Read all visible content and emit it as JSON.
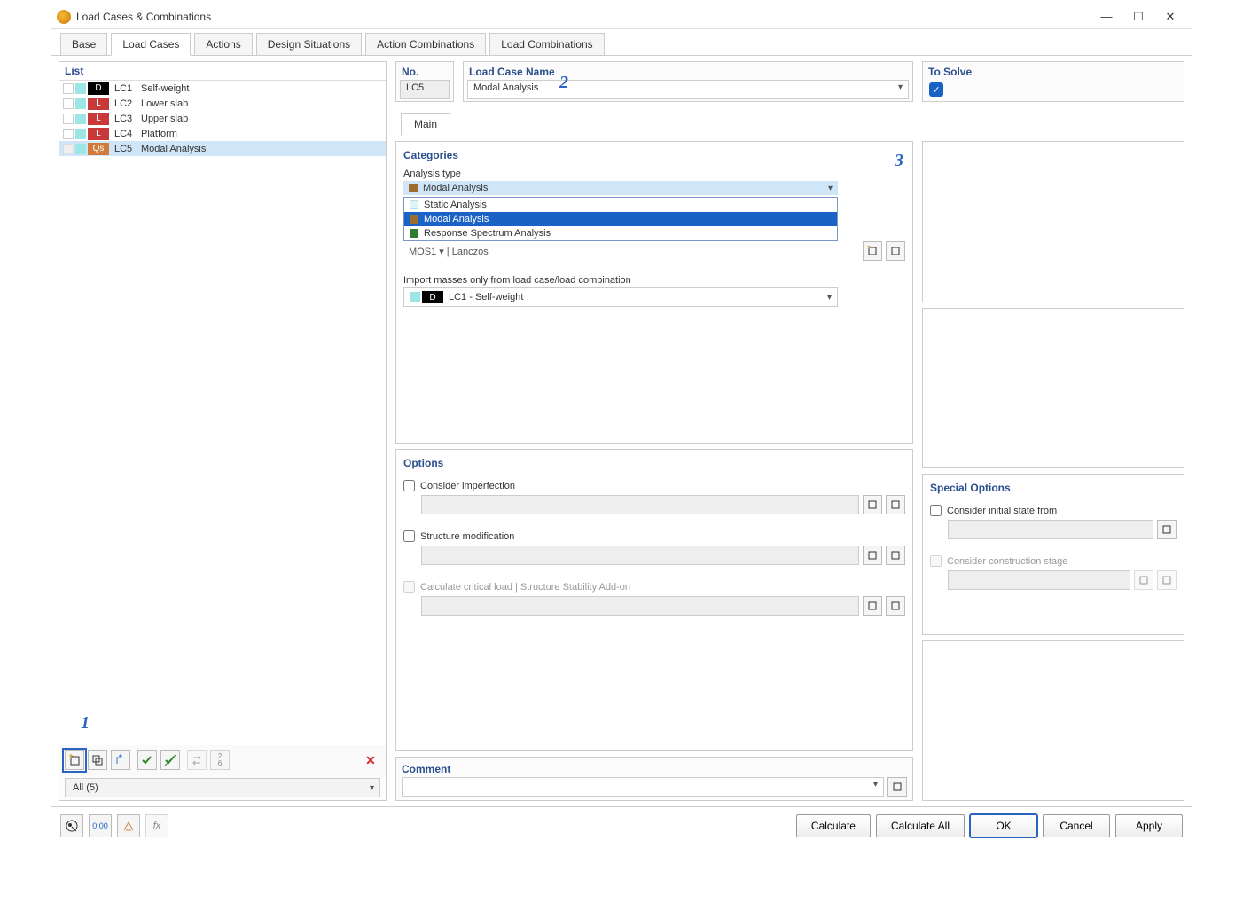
{
  "window": {
    "title": "Load Cases & Combinations"
  },
  "main_tabs": [
    "Base",
    "Load Cases",
    "Actions",
    "Design Situations",
    "Action Combinations",
    "Load Combinations"
  ],
  "active_tab": 1,
  "list": {
    "head": "List",
    "items": [
      {
        "id": "LC1",
        "tag": "D",
        "tagcls": "d",
        "name": "Self-weight"
      },
      {
        "id": "LC2",
        "tag": "L",
        "tagcls": "l",
        "name": "Lower slab"
      },
      {
        "id": "LC3",
        "tag": "L",
        "tagcls": "l",
        "name": "Upper slab"
      },
      {
        "id": "LC4",
        "tag": "L",
        "tagcls": "l",
        "name": "Platform"
      },
      {
        "id": "LC5",
        "tag": "Qs",
        "tagcls": "qs",
        "name": "Modal Analysis",
        "sel": true,
        "pre": "blank"
      }
    ],
    "filter": "All (5)"
  },
  "fields": {
    "no_label": "No.",
    "no_value": "LC5",
    "name_label": "Load Case Name",
    "name_value": "Modal Analysis",
    "solve_label": "To Solve",
    "main_tab": "Main"
  },
  "categories": {
    "head": "Categories",
    "atype_label": "Analysis type",
    "atype_selected": "Modal Analysis",
    "atype_options": [
      {
        "name": "Static Analysis",
        "cls": "pale"
      },
      {
        "name": "Modal Analysis",
        "cls": "brown",
        "hl": true
      },
      {
        "name": "Response Spectrum Analysis",
        "cls": "green"
      }
    ],
    "truncated_row": "MOS1  ▾ | Lanczos",
    "import_label": "Import masses only from load case/load combination",
    "import_value": "LC1 - Self-weight"
  },
  "options": {
    "head": "Options",
    "imperfection": "Consider imperfection",
    "structure": "Structure modification",
    "critical": "Calculate critical load | Structure Stability Add-on"
  },
  "special": {
    "head": "Special Options",
    "initial": "Consider initial state from",
    "stage": "Consider construction stage"
  },
  "comment": {
    "head": "Comment"
  },
  "buttons": {
    "calc": "Calculate",
    "calcall": "Calculate All",
    "ok": "OK",
    "cancel": "Cancel",
    "apply": "Apply"
  },
  "annot": {
    "a1": "1",
    "a2": "2",
    "a3": "3"
  }
}
